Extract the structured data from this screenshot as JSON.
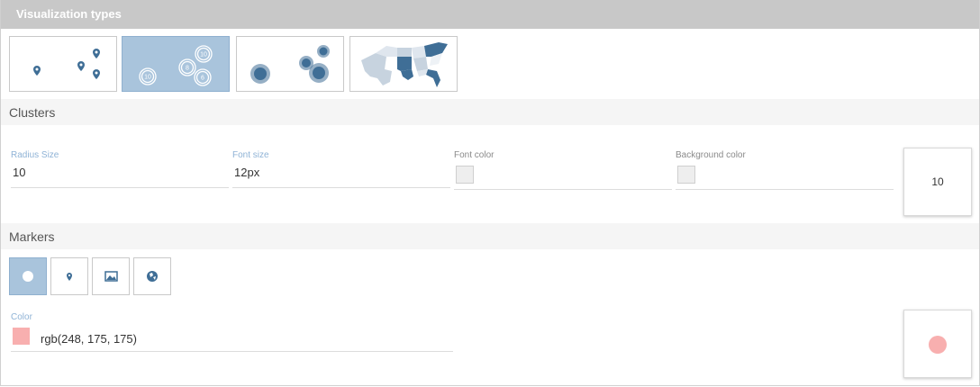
{
  "header": {
    "title": "Visualization types"
  },
  "visualization_types": [
    {
      "id": "markers",
      "icon": "map-pin-markers-icon",
      "selected": false
    },
    {
      "id": "clusters",
      "icon": "cluster-circles-icon",
      "selected": true,
      "cluster_labels": [
        "10",
        "8",
        "10",
        "6"
      ]
    },
    {
      "id": "bubbles",
      "icon": "proportional-bubbles-icon",
      "selected": false
    },
    {
      "id": "choropleth",
      "icon": "choropleth-us-map-icon",
      "selected": false
    }
  ],
  "clusters": {
    "section_title": "Clusters",
    "radius_size": {
      "label": "Radius Size",
      "value": "10"
    },
    "font_size": {
      "label": "Font size",
      "value": "12px"
    },
    "font_color": {
      "label": "Font color",
      "color": "#eeeeee"
    },
    "background_color": {
      "label": "Background color",
      "color": "#eeeeee"
    },
    "preview_text": "10"
  },
  "markers": {
    "section_title": "Markers",
    "types": [
      {
        "id": "circle",
        "icon": "circle-icon",
        "selected": true
      },
      {
        "id": "pin",
        "icon": "map-pin-icon",
        "selected": false
      },
      {
        "id": "image",
        "icon": "image-icon",
        "selected": false
      },
      {
        "id": "globe",
        "icon": "globe-icon",
        "selected": false
      }
    ],
    "color": {
      "label": "Color",
      "value": "rgb(248, 175, 175)",
      "hex": "#f8afaf"
    }
  },
  "colors": {
    "accent_blue": "#3f6e96",
    "selected_tile": "#a9c4dc",
    "label_blue": "#8fb3d6"
  }
}
